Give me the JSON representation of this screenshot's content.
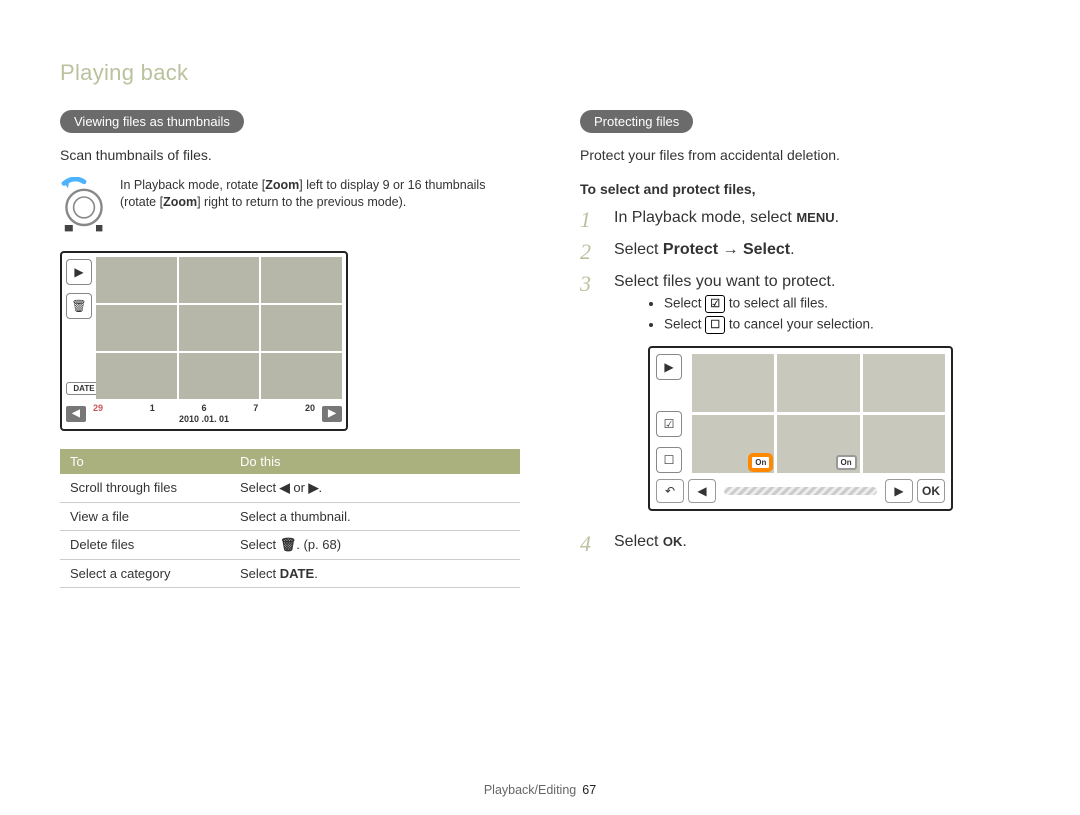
{
  "section_title": "Playing back",
  "left": {
    "pill": "Viewing files as thumbnails",
    "intro": "Scan thumbnails of files.",
    "tip": {
      "pre": "In Playback mode, rotate [",
      "b1": "Zoom",
      "mid": "] left to display 9 or 16 thumbnails (rotate [",
      "b2": "Zoom",
      "post": "] right to return to the previous mode)."
    },
    "screen": {
      "date_label": "DATE",
      "cal_nums": [
        "29",
        "1",
        "6",
        "7",
        "20"
      ],
      "cal_date": "2010 .01. 01"
    },
    "table": {
      "head": [
        "To",
        "Do this"
      ],
      "rows": [
        {
          "to": "Scroll through files",
          "do_pre": "Select ",
          "do_glyph": "◀",
          "do_mid": " or ",
          "do_glyph2": "▶",
          "do_post": "."
        },
        {
          "to": "View a file",
          "do_pre": "Select a thumbnail.",
          "do_glyph": "",
          "do_mid": "",
          "do_glyph2": "",
          "do_post": ""
        },
        {
          "to": "Delete files",
          "do_pre": "Select ",
          "do_glyph": "🗑",
          "do_mid": ". (p. 68)",
          "do_glyph2": "",
          "do_post": ""
        },
        {
          "to": "Select a category",
          "do_pre": "Select ",
          "do_glyph": "DATE",
          "do_mid": ".",
          "do_glyph2": "",
          "do_post": ""
        }
      ]
    }
  },
  "right": {
    "pill": "Protecting files",
    "intro": "Protect your files from accidental deletion.",
    "sub": "To select and protect files,",
    "steps": [
      {
        "pre": "In Playback mode, select ",
        "glyph": "MENU",
        "post": "."
      },
      {
        "pre": "Select ",
        "b1": "Protect",
        "arrow": " → ",
        "b2": "Select",
        "post": "."
      },
      {
        "pre": "Select files you want to protect.",
        "post": ""
      },
      {
        "pre": "Select ",
        "glyph": "OK",
        "post": "."
      }
    ],
    "bullets": [
      {
        "pre": "Select ",
        "glyph": "☑ₐₗₗ",
        "post": " to select all files."
      },
      {
        "pre": "Select ",
        "glyph": "☐⤺",
        "post": " to cancel your selection."
      }
    ],
    "protect_screen": {
      "on_label": "On"
    }
  },
  "footer": {
    "section": "Playback/Editing",
    "page": "67"
  }
}
